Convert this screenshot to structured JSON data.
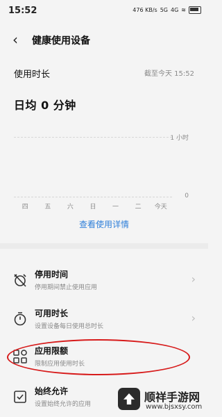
{
  "status_bar": {
    "time": "15:52",
    "net_speed": "476 KB/s",
    "signal_1": "5G",
    "signal_2": "4G"
  },
  "header": {
    "title": "健康使用设备"
  },
  "usage": {
    "label": "使用时长",
    "date": "截至今天 15:52",
    "daily_average": "日均 0 分钟"
  },
  "chart_data": {
    "type": "bar",
    "categories": [
      "四",
      "五",
      "六",
      "日",
      "一",
      "二",
      "今天"
    ],
    "values": [
      0,
      0,
      0,
      0,
      0,
      0,
      0
    ],
    "y_ticks": [
      "1 小时",
      "0"
    ],
    "grid": true
  },
  "detail_link": "查看使用详情",
  "settings": [
    {
      "name": "停用时间",
      "desc": "停用期间禁止使用应用",
      "icon": "alarm-off-icon"
    },
    {
      "name": "可用时长",
      "desc": "设置设备每日使用总时长",
      "icon": "timer-icon"
    },
    {
      "name": "应用限额",
      "desc": "限制应用使用时长",
      "icon": "apps-grid-icon"
    },
    {
      "name": "始终允许",
      "desc": "设置始终允许的应用",
      "icon": "check-square-icon"
    }
  ],
  "watermark": {
    "title": "顺祥手游网",
    "url": "www.bjsxsy.com"
  },
  "colors": {
    "link": "#2f7fd9",
    "highlight": "#d71b1b"
  }
}
